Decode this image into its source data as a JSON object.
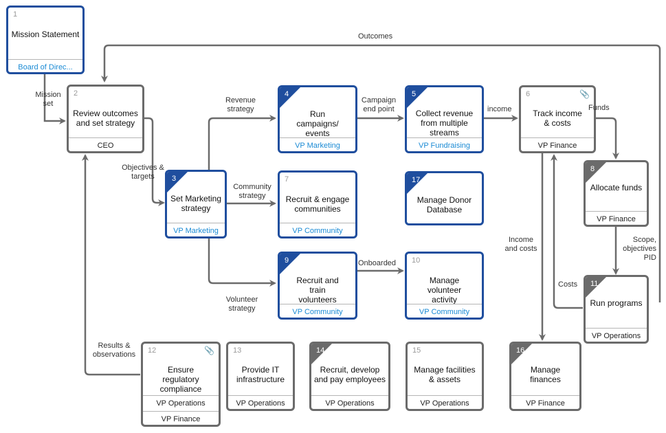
{
  "nodes": {
    "n1": {
      "num": "1",
      "title": "Mission Statement",
      "roles": [
        "Board of Direc..."
      ]
    },
    "n2": {
      "num": "2",
      "title": "Review outcomes and set strategy",
      "roles": [
        "CEO"
      ]
    },
    "n3": {
      "num": "3",
      "title": "Set Marketing strategy",
      "roles": [
        "VP Marketing"
      ]
    },
    "n4": {
      "num": "4",
      "title": "Run campaigns/ events",
      "roles": [
        "VP Marketing"
      ]
    },
    "n5": {
      "num": "5",
      "title": "Collect revenue from multiple streams",
      "roles": [
        "VP Fundraising"
      ]
    },
    "n6": {
      "num": "6",
      "title": "Track income & costs",
      "roles": [
        "VP Finance"
      ],
      "attachment": "paperclip"
    },
    "n7": {
      "num": "7",
      "title": "Recruit & engage communities",
      "roles": [
        "VP Community"
      ]
    },
    "n8": {
      "num": "8",
      "title": "Allocate funds",
      "roles": [
        "VP Finance"
      ]
    },
    "n9": {
      "num": "9",
      "title": "Recruit and train volunteers",
      "roles": [
        "VP Community"
      ]
    },
    "n10": {
      "num": "10",
      "title": "Manage volunteer activity",
      "roles": [
        "VP Community"
      ]
    },
    "n11": {
      "num": "11",
      "title": "Run programs",
      "roles": [
        "VP Operations"
      ]
    },
    "n12": {
      "num": "12",
      "title": "Ensure regulatory compliance",
      "roles": [
        "VP Operations",
        "VP Finance"
      ],
      "attachment": "paperclip"
    },
    "n13": {
      "num": "13",
      "title": "Provide IT infrastructure",
      "roles": [
        "VP Operations"
      ]
    },
    "n14": {
      "num": "14",
      "title": "Recruit, develop and pay employees",
      "roles": [
        "VP Operations"
      ]
    },
    "n15": {
      "num": "15",
      "title": "Manage facilities & assets",
      "roles": [
        "VP Operations"
      ]
    },
    "n16": {
      "num": "16",
      "title": "Manage finances",
      "roles": [
        "VP Finance"
      ]
    },
    "n17": {
      "num": "17",
      "title": "Manage Donor Database",
      "roles": []
    }
  },
  "edge_labels": {
    "outcomes": "Outcomes",
    "mission_set": "Mission set",
    "objectives_targets": "Objectives & targets",
    "revenue_strategy": "Revenue strategy",
    "community_strategy": "Community strategy",
    "volunteer_strategy": "Volunteer strategy",
    "campaign_end_point": "Campaign end point",
    "income": "income",
    "funds": "Funds",
    "income_and_costs": "Income and costs",
    "scope_objectives_pid": "Scope, objectives PID",
    "costs": "Costs",
    "onboarded": "Onboarded",
    "results_observations": "Results & observations"
  },
  "colors": {
    "accent_blue": "#1f4e9e",
    "role_blue": "#1a8ad4",
    "neutral": "#6b6b6b"
  }
}
